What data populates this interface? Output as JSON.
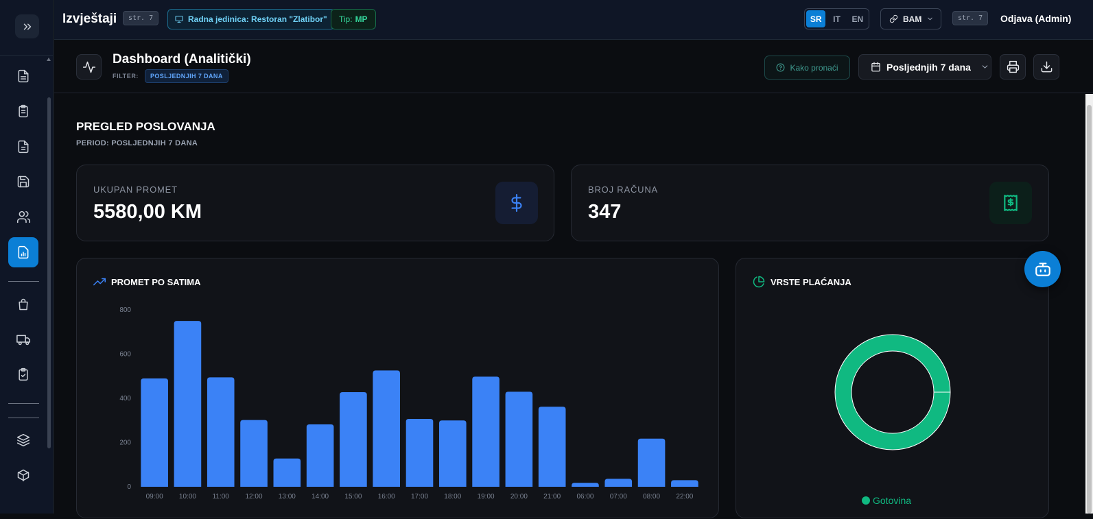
{
  "topbar": {
    "title": "Izvještaji",
    "shortcut": "str. 7",
    "unit_chip": "Radna jedinica: Restoran \"Zlatibor\"",
    "type_label": "Tip:",
    "type_value": "MP",
    "languages": [
      "SR",
      "IT",
      "EN"
    ],
    "active_language": "SR",
    "currency": "BAM",
    "shortcut2": "str. 7",
    "logout": "Odjava (Admin)"
  },
  "header": {
    "title": "Dashboard (Analitički)",
    "filter_label": "FILTER:",
    "filter_value": "POSLJEDNJIH 7 DANA",
    "help_button": "Kako pronaći",
    "date_range": "Posljednjih 7 dana"
  },
  "overview": {
    "title": "PREGLED POSLOVANJA",
    "period": "PERIOD: POSLJEDNJIH 7 DANA"
  },
  "kpis": {
    "turnover_label": "UKUPAN PROMET",
    "turnover_value": "5580,00 KM",
    "receipts_label": "BROJ RAČUNA",
    "receipts_value": "347"
  },
  "hourly_chart_title": "PROMET PO SATIMA",
  "payments_title": "VRSTE PLAĆANJA",
  "colors": {
    "accent": "#0b7fd6",
    "bar": "#3b82f6",
    "green": "#10b981"
  },
  "sidebar_icons": [
    "file-text-icon",
    "clipboard-list-icon",
    "file-icon",
    "save-icon",
    "users-icon",
    "reports-icon",
    "shopping-bag-icon",
    "truck-icon",
    "clipboard-check-icon",
    "layers-icon",
    "box-icon"
  ],
  "chart_data": [
    {
      "type": "bar",
      "title": "PROMET PO SATIMA",
      "categories": [
        "09:00",
        "10:00",
        "11:00",
        "12:00",
        "13:00",
        "14:00",
        "15:00",
        "16:00",
        "17:00",
        "18:00",
        "19:00",
        "20:00",
        "21:00",
        "06:00",
        "07:00",
        "08:00",
        "22:00"
      ],
      "values": [
        490,
        750,
        495,
        302,
        128,
        282,
        428,
        526,
        307,
        300,
        498,
        430,
        362,
        18,
        36,
        218,
        30
      ],
      "ylim": [
        0,
        800
      ],
      "yticks": [
        0,
        200,
        400,
        600,
        800
      ],
      "grid": false
    },
    {
      "type": "pie",
      "title": "VRSTE PLAĆANJA",
      "labels": [
        "Gotovina"
      ],
      "values": [
        100
      ],
      "colors": [
        "#10b981"
      ],
      "legend": "bottom"
    }
  ]
}
